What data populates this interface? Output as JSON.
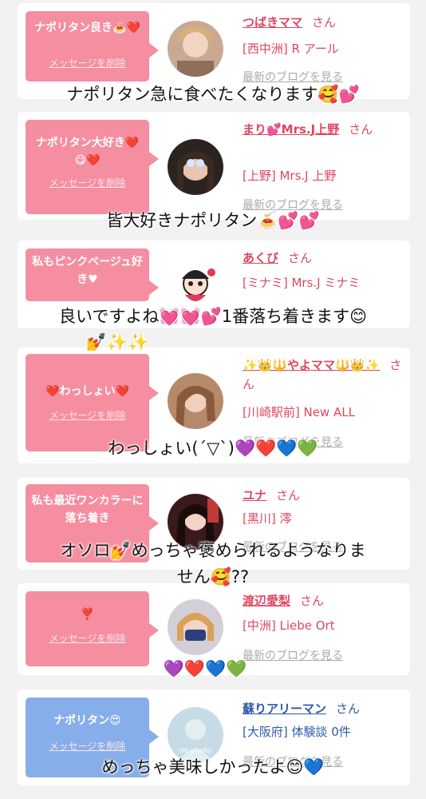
{
  "cards": [
    {
      "bubble_text": "ナポリタン良き🍝❤️",
      "delete_label": "メッセージを削除",
      "name": "つばきママ",
      "honorific": "さん",
      "shop": "[西中洲] R アール",
      "blog_label": "最新のブログを見る",
      "bubble_color": "#f58ea0"
    },
    {
      "bubble_text": "ナポリタン大好き❤️😋❤️",
      "delete_label": "メッセージを削除",
      "name": "まり💕Mrs.J上野",
      "honorific": "さん",
      "shop": "[上野] Mrs.J 上野",
      "blog_label": "最新のブログを見る",
      "bubble_color": "#f58ea0"
    },
    {
      "bubble_text": "私もピンクベージュ好き♥",
      "delete_label": "メッセージを削除",
      "name": "あくび",
      "honorific": "さん",
      "shop": "[ミナミ] Mrs.J ミナミ",
      "blog_label": "最新のブログを見る",
      "bubble_color": "#f58ea0"
    },
    {
      "bubble_text": "❤️わっしょい❤️",
      "delete_label": "メッセージを削除",
      "name": "✨👑🔱やよママ🔱👑✨",
      "honorific": "さん",
      "shop": "[川崎駅前] New ALL",
      "blog_label": "最新のブログを見る",
      "bubble_color": "#f58ea0"
    },
    {
      "bubble_text": "私も最近ワンカラーに落ち着き",
      "delete_label": "メッセージを削除",
      "name": "ユナ",
      "honorific": "さん",
      "shop": "[黒川] 澪",
      "blog_label": "最新のブログを見る",
      "bubble_color": "#f58ea0"
    },
    {
      "bubble_text": "❣️",
      "delete_label": "メッセージを削除",
      "name": "渡辺愛梨",
      "honorific": "さん",
      "shop": "[中洲] Liebe Ort",
      "blog_label": "最新のブログを見る",
      "bubble_color": "#f58ea0"
    },
    {
      "bubble_text": "ナポリタン😍",
      "delete_label": "メッセージを削除",
      "name": "蘇りアリーマン",
      "honorific": "さん",
      "shop": "[大阪府] 体験談 0件",
      "blog_label": "最新のブログを見る",
      "bubble_color": "#86aeea",
      "avatar_text": "no photo"
    }
  ],
  "captions": [
    "ナポリタン急に食べたくなります🥰💕",
    "皆大好きナポリタン🍝💕💕",
    "良いですよね💓💓💕1番落ち着きます😊",
    "💅✨✨",
    "わっしょい(´▽`)💜❤️💙💚",
    "オソロ💅めっちゃ褒められるようなりま",
    "せん🥰??",
    "💜❤️💙💚",
    "めっちゃ美味しかったよ😊💙"
  ]
}
